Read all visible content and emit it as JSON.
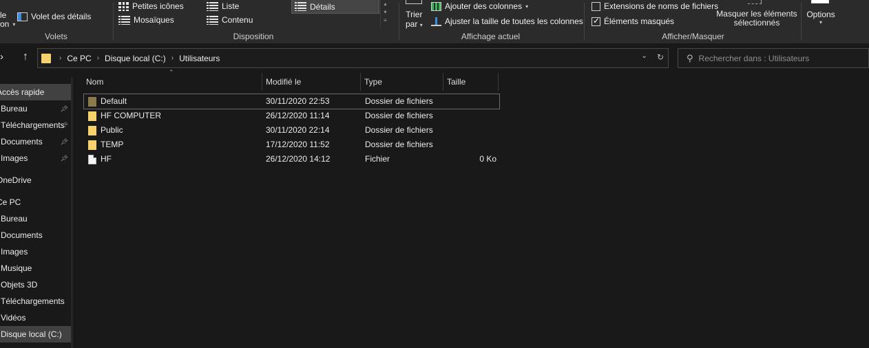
{
  "ribbon": {
    "volets": {
      "left_label_1": "le",
      "left_label_2": "on",
      "details_pane": "Volet des détails",
      "title": "Volets"
    },
    "disposition": {
      "petites_icones": "Petites icônes",
      "mosaiques": "Mosaïques",
      "liste": "Liste",
      "contenu": "Contenu",
      "details": "Détails",
      "title": "Disposition"
    },
    "affichage": {
      "trier": "Trier",
      "par": "par",
      "ajouter_colonnes": "Ajouter des colonnes",
      "ajuster": "Ajuster la taille de toutes les colonnes",
      "title": "Affichage actuel"
    },
    "afficher": {
      "extensions": "Extensions de noms de fichiers",
      "extensions_checked": false,
      "masques": "Éléments masqués",
      "masques_checked": true,
      "masquer_1": "Masquer les éléments",
      "masquer_2": "sélectionnés",
      "title": "Afficher/Masquer"
    },
    "options": "Options"
  },
  "address": {
    "crumbs": [
      "Ce PC",
      "Disque local (C:)",
      "Utilisateurs"
    ]
  },
  "search": {
    "placeholder": "Rechercher dans : Utilisateurs"
  },
  "sidebar": {
    "items": [
      {
        "label": "Accès rapide",
        "pinned": false
      },
      {
        "label": "Bureau",
        "pinned": true
      },
      {
        "label": "Téléchargements",
        "pinned": true
      },
      {
        "label": "Documents",
        "pinned": true
      },
      {
        "label": "Images",
        "pinned": true
      },
      {
        "label": "OneDrive",
        "pinned": false
      },
      {
        "label": "Ce PC",
        "pinned": false
      },
      {
        "label": "Bureau",
        "pinned": false
      },
      {
        "label": "Documents",
        "pinned": false
      },
      {
        "label": "Images",
        "pinned": false
      },
      {
        "label": "Musique",
        "pinned": false
      },
      {
        "label": "Objets 3D",
        "pinned": false
      },
      {
        "label": "Téléchargements",
        "pinned": false
      },
      {
        "label": "Vidéos",
        "pinned": false
      },
      {
        "label": "Disque local (C:)",
        "pinned": false
      }
    ]
  },
  "table": {
    "columns": [
      "Nom",
      "Modifié le",
      "Type",
      "Taille"
    ],
    "rows": [
      {
        "name": "Default",
        "modified": "30/11/2020 22:53",
        "type": "Dossier de fichiers",
        "size": "",
        "icon": "folder-dim-icon"
      },
      {
        "name": "HF COMPUTER",
        "modified": "26/12/2020 11:14",
        "type": "Dossier de fichiers",
        "size": "",
        "icon": "folder-icon"
      },
      {
        "name": "Public",
        "modified": "30/11/2020 22:14",
        "type": "Dossier de fichiers",
        "size": "",
        "icon": "folder-icon"
      },
      {
        "name": "TEMP",
        "modified": "17/12/2020 11:52",
        "type": "Dossier de fichiers",
        "size": "",
        "icon": "folder-icon"
      },
      {
        "name": "HF",
        "modified": "26/12/2020 14:12",
        "type": "Fichier",
        "size": "0 Ko",
        "icon": "file-icon"
      }
    ]
  },
  "colors": {
    "ribbon_bg": "#2b2b2b",
    "window_bg": "#191919",
    "folder": "#f5d26d",
    "highlight": "#414141"
  }
}
